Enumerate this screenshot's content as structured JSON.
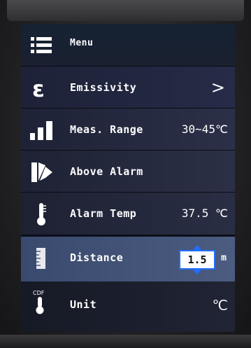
{
  "menu": {
    "header_label": "Menu",
    "items": [
      {
        "label": "Emissivity",
        "value": "",
        "control": ">"
      },
      {
        "label": "Meas. Range",
        "value": "30~45℃"
      },
      {
        "label": "Above Alarm",
        "value": ""
      },
      {
        "label": "Alarm Temp",
        "value": "37.5 ℃"
      },
      {
        "label": "Distance",
        "value": "1.5",
        "unit": "m",
        "selected": true
      },
      {
        "label": "Unit",
        "value": "℃",
        "icon_text": "CDF"
      }
    ]
  },
  "icons": {
    "header": "menu-list-icon",
    "emissivity": "epsilon-icon",
    "meas_range": "signal-bars-icon",
    "above_alarm": "fan-flag-icon",
    "alarm_temp": "thermometer-icon",
    "distance": "ruler-icon",
    "unit": "thermometer-cf-icon"
  },
  "colors": {
    "selection_highlight": "#4c5c80",
    "value_box_border": "#1f6fff"
  }
}
